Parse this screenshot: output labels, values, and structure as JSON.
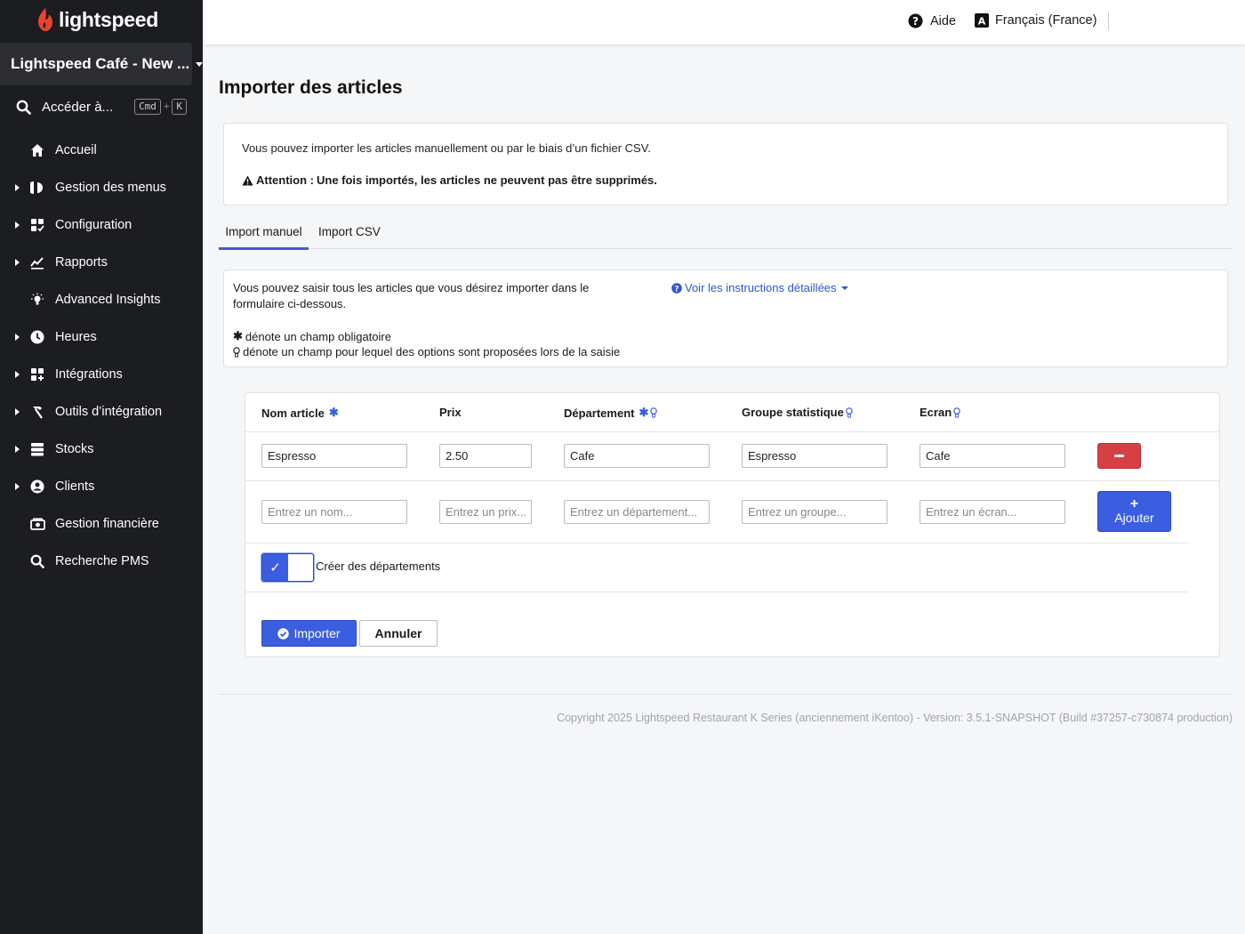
{
  "brand": {
    "name": "lightspeed",
    "color": "#e8452c"
  },
  "sidebar": {
    "store_name": "Lightspeed Café - New ...",
    "goto_label": "Accéder à...",
    "shortcut_cmd": "Cmd",
    "shortcut_plus": "+",
    "shortcut_key": "K",
    "items": [
      {
        "label": "Accueil",
        "icon": "home-icon",
        "expandable": false
      },
      {
        "label": "Gestion des menus",
        "icon": "menu-management-icon",
        "expandable": true
      },
      {
        "label": "Configuration",
        "icon": "configuration-icon",
        "expandable": true
      },
      {
        "label": "Rapports",
        "icon": "reports-icon",
        "expandable": true
      },
      {
        "label": "Advanced Insights",
        "icon": "lightbulb-icon",
        "expandable": false
      },
      {
        "label": "Heures",
        "icon": "clock-icon",
        "expandable": true
      },
      {
        "label": "Intégrations",
        "icon": "integrations-icon",
        "expandable": true
      },
      {
        "label": "Outils d’intégration",
        "icon": "hammer-icon",
        "expandable": true
      },
      {
        "label": "Stocks",
        "icon": "stock-icon",
        "expandable": true
      },
      {
        "label": "Clients",
        "icon": "user-icon",
        "expandable": true
      },
      {
        "label": "Gestion financière",
        "icon": "money-icon",
        "expandable": false
      },
      {
        "label": "Recherche PMS",
        "icon": "search-icon",
        "expandable": false
      }
    ]
  },
  "topbar": {
    "help_label": "Aide",
    "language_label": "Français (France)",
    "language_icon_letter": "A"
  },
  "main": {
    "title": "Importer des articles",
    "info_text": "Vous pouvez importer les articles manuellement ou par le biais d’un fichier CSV.",
    "warning_prefix": "Attention :",
    "warning_text": "Une fois importés, les articles ne peuvent pas être supprimés.",
    "tabs": [
      {
        "label": "Import manuel",
        "active": true
      },
      {
        "label": "Import CSV",
        "active": false
      }
    ],
    "instructions": {
      "line1": "Vous pouvez saisir tous les articles que vous désirez importer dans le",
      "line2": "formulaire ci-dessous.",
      "required_note": "dénote un champ obligatoire",
      "suggest_note": "dénote un champ pour lequel des options sont proposées lors de la saisie",
      "link_label": "Voir les instructions détaillées"
    },
    "table": {
      "headers": [
        "Nom article",
        "Prix",
        "Département",
        "Groupe statistique",
        "Ecran"
      ],
      "rows": [
        {
          "name": "Espresso",
          "price": "2.50",
          "department": "Cafe",
          "group": "Espresso",
          "screen": "Cafe"
        }
      ],
      "placeholders": {
        "name": "Entrez un nom...",
        "price": "Entrez un prix...",
        "department": "Entrez un département...",
        "group": "Entrez un groupe...",
        "screen": "Entrez un écran..."
      },
      "add_label": "Ajouter"
    },
    "create_departments_label": "Créer des départements",
    "create_departments_checked": true,
    "import_label": "Importer",
    "cancel_label": "Annuler"
  },
  "footer": "Copyright 2025 Lightspeed Restaurant K Series (anciennement iKentoo) - Version: 3.5.1-SNAPSHOT (Build #37257-c730874 production)",
  "colors": {
    "sidebar_bg": "#1c1d21",
    "accent": "#3b5ee0",
    "danger": "#d64045",
    "link": "#2f55d4"
  }
}
